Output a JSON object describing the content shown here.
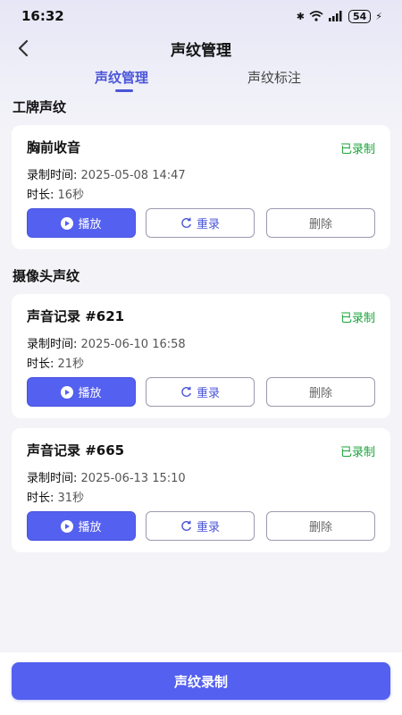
{
  "status_bar": {
    "time": "16:32",
    "battery": "54"
  },
  "nav": {
    "title": "声纹管理"
  },
  "tabs": [
    {
      "label": "声纹管理",
      "active": true
    },
    {
      "label": "声纹标注",
      "active": false
    }
  ],
  "sections": [
    {
      "title": "工牌声纹"
    },
    {
      "title": "摄像头声纹"
    }
  ],
  "cards": [
    {
      "name": "胸前收音",
      "status": "已录制",
      "time_label": "录制时间:",
      "time_value": "2025-05-08 14:47",
      "duration_label": "时长:",
      "duration_value": "16秒"
    },
    {
      "name": "声音记录 #621",
      "status": "已录制",
      "time_label": "录制时间:",
      "time_value": "2025-06-10 16:58",
      "duration_label": "时长:",
      "duration_value": "21秒"
    },
    {
      "name": "声音记录 #665",
      "status": "已录制",
      "time_label": "录制时间:",
      "time_value": "2025-06-13 15:10",
      "duration_label": "时长:",
      "duration_value": "31秒"
    }
  ],
  "buttons": {
    "play": "播放",
    "rerecord": "重录",
    "delete": "删除"
  },
  "footer": {
    "record_button": "声纹录制"
  },
  "colors": {
    "accent": "#5460ef",
    "recorded": "#1aa33a"
  }
}
